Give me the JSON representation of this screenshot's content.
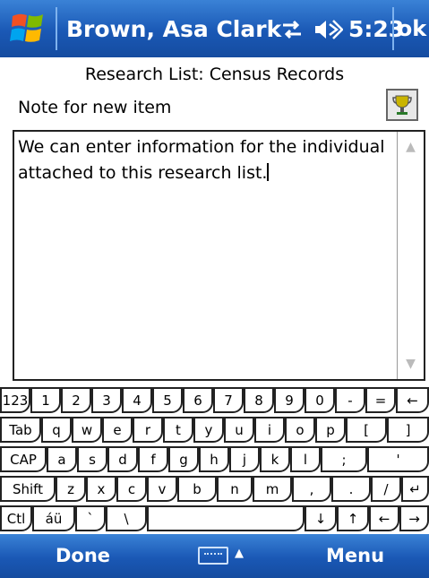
{
  "titlebar": {
    "title": "Brown, Asa Clark",
    "time": "5:23",
    "ok_label": "ok",
    "accent": "#1a58b5"
  },
  "heading": "Research List: Census Records",
  "note_label": "Note for new item",
  "note_text": "We can enter information for the individual attached to this research list.",
  "keyboard": {
    "rows": [
      [
        "123",
        "1",
        "2",
        "3",
        "4",
        "5",
        "6",
        "7",
        "8",
        "9",
        "0",
        "-",
        "=",
        "←"
      ],
      [
        "Tab",
        "q",
        "w",
        "e",
        "r",
        "t",
        "y",
        "u",
        "i",
        "o",
        "p",
        "[",
        "]"
      ],
      [
        "CAP",
        "a",
        "s",
        "d",
        "f",
        "g",
        "h",
        "j",
        "k",
        "l",
        ";",
        "'"
      ],
      [
        "Shift",
        "z",
        "x",
        "c",
        "v",
        "b",
        "n",
        "m",
        ",",
        ".",
        "/",
        "↵"
      ],
      [
        "Ctl",
        "áü",
        "`",
        "\\",
        "",
        " ↓",
        "↑",
        "←",
        "→"
      ]
    ]
  },
  "bottombar": {
    "done_label": "Done",
    "menu_label": "Menu"
  }
}
